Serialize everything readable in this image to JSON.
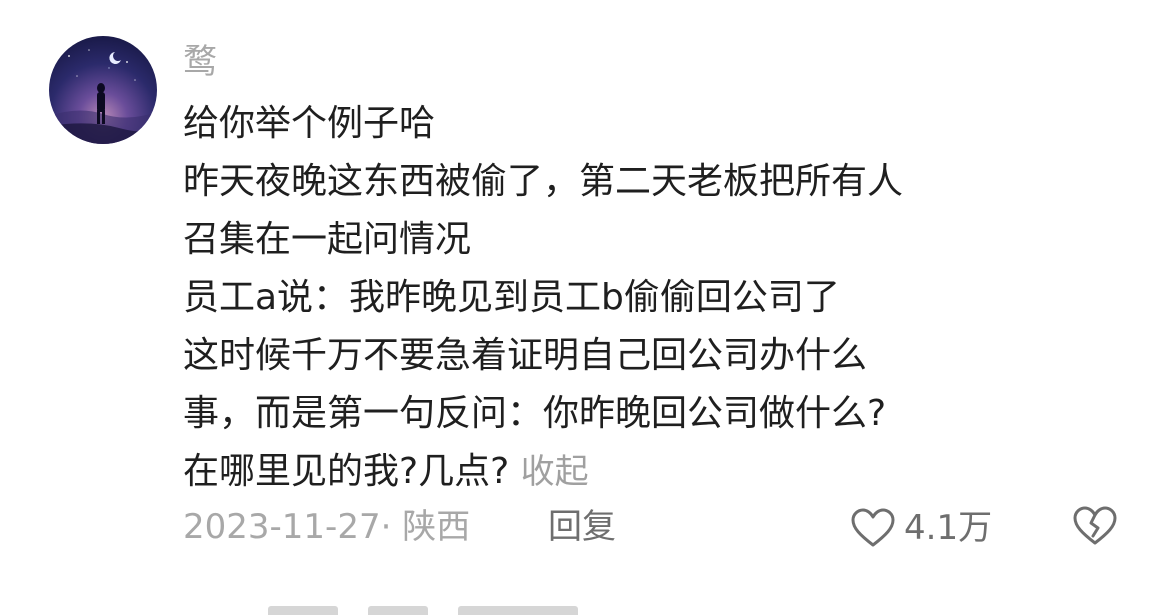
{
  "comment": {
    "username": "鹜",
    "lines": [
      "给你举个例子哈",
      "昨天夜晚这东西被偷了，第二天老板把所有人",
      "召集在一起问情况",
      "员工a说：我昨晚见到员工b偷偷回公司了",
      "这时候千万不要急着证明自己回公司办什么",
      "事，而是第一句反问：你昨晚回公司做什么?",
      "在哪里见的我?几点?"
    ],
    "collapse_label": "收起",
    "date": "2023-11-27",
    "location_separator": "·",
    "location": "陕西",
    "reply_label": "回复",
    "like_count": "4.1万",
    "icons": {
      "like": "heart-outline-icon",
      "dislike": "broken-heart-icon"
    },
    "colors": {
      "text": "#1f1f1f",
      "muted": "#a8a8a8",
      "action": "#6e6e6e"
    }
  }
}
